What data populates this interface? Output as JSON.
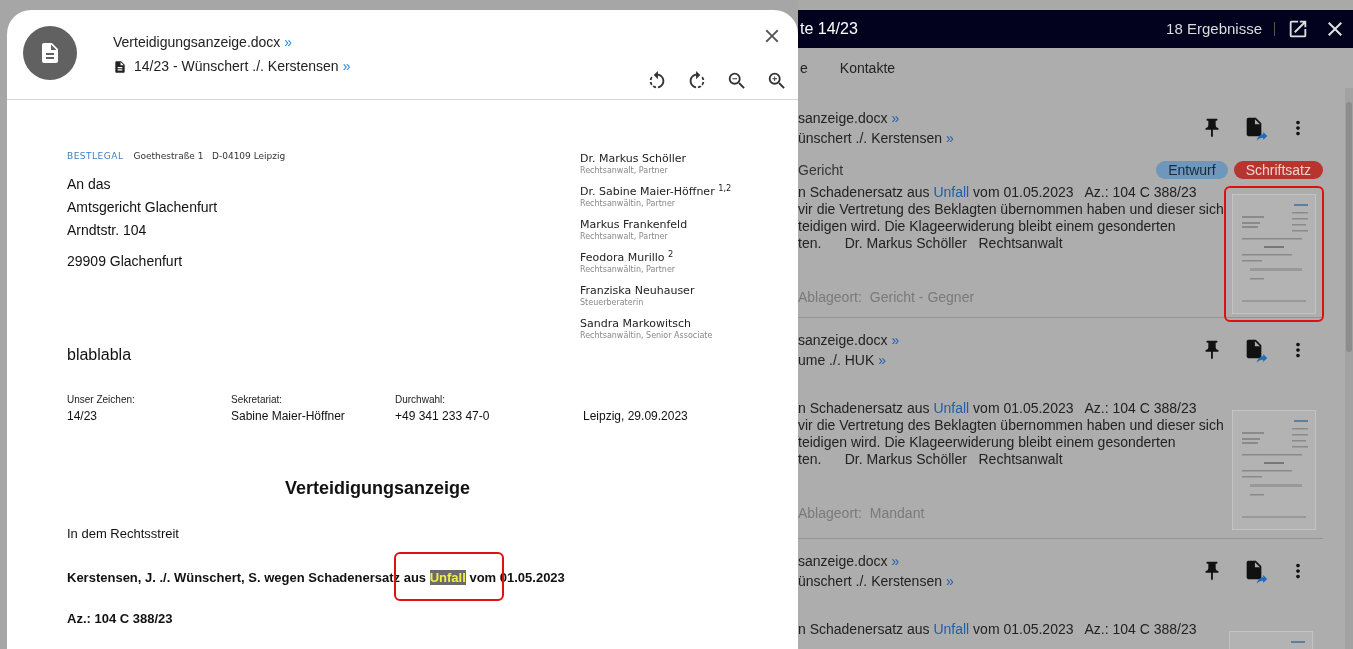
{
  "app": {
    "title": "te 14/23",
    "result_count": "18 Ergebnisse",
    "tabs": [
      {
        "label": "e",
        "selected": false
      },
      {
        "label": "Kontakte",
        "selected": false
      }
    ]
  },
  "results": [
    {
      "title": "sanzeige.docx",
      "title_link": "»",
      "case": "ünschert ./. Kerstensen",
      "case_link": "»",
      "category": "Gericht",
      "badges": [
        {
          "label": "Entwurf",
          "color": "#6f96bb"
        },
        {
          "label": "Schriftsatz",
          "color": "#b8352f"
        }
      ],
      "snippet": [
        [
          {
            "text": "n Schadenersatz aus ",
            "hit": false
          },
          {
            "text": "Unfall",
            "hit": true
          },
          {
            "text": " vom 01.05.2023   Az.: 104 C 388/23",
            "hit": false
          }
        ],
        [
          {
            "text": "vir die Vertretung des Beklagten übernommen haben und dieser sich",
            "hit": false
          }
        ],
        [
          {
            "text": "teidigen wird. Die Klageerwiderung bleibt einem gesonderten",
            "hit": false
          }
        ],
        [
          {
            "text": "ten.      Dr. Markus Schöller   Rechtsanwalt",
            "hit": false
          }
        ]
      ],
      "location_label": "Ablageort:",
      "location": "Gericht - Gegner",
      "thumbnail_outlined": true
    },
    {
      "title": "sanzeige.docx",
      "title_link": "»",
      "case": "ume ./. HUK",
      "case_link": "»",
      "snippet": [
        [
          {
            "text": "n Schadenersatz aus ",
            "hit": false
          },
          {
            "text": "Unfall",
            "hit": true
          },
          {
            "text": " vom 01.05.2023   Az.: 104 C 388/23",
            "hit": false
          }
        ],
        [
          {
            "text": "vir die Vertretung des Beklagten übernommen haben und dieser sich",
            "hit": false
          }
        ],
        [
          {
            "text": "teidigen wird. Die Klageerwiderung bleibt einem gesonderten",
            "hit": false
          }
        ],
        [
          {
            "text": "ten.      Dr. Markus Schöller   Rechtsanwalt",
            "hit": false
          }
        ]
      ],
      "location_label": "Ablageort:",
      "location": "Mandant",
      "thumbnail_outlined": false
    },
    {
      "title": "sanzeige.docx",
      "title_link": "»",
      "case": "ünschert ./. Kerstensen",
      "case_link": "»",
      "snippet": [
        [
          {
            "text": "n Schadenersatz aus ",
            "hit": false
          },
          {
            "text": "Unfall",
            "hit": true
          },
          {
            "text": " vom 01.05.2023   Az.: 104 C 388/23",
            "hit": false
          }
        ]
      ],
      "thumbnail_outlined": false
    }
  ],
  "viewer": {
    "file_name": "Verteidigungsanzeige.docx",
    "file_link": "»",
    "case": "14/23 - Wünschert ./. Kerstensen",
    "case_link": "»",
    "document": {
      "firm": "BESTLEGAL",
      "firm_address": "Goethestraße 1   D-04109 Leipzig",
      "recipient": [
        "An das",
        "Amtsgericht Glachenfurt",
        "Arndtstr. 104"
      ],
      "recipient_city": "29909 Glachenfurt",
      "note": "blablabla",
      "partners": [
        {
          "name": "Dr. Markus Schöller",
          "role": "Rechtsanwalt, Partner"
        },
        {
          "name": "Dr. Sabine Maier-Höffner $^{1,2}$",
          "role": "Rechtsanwältin, Partner"
        },
        {
          "name": "Markus Frankenfeld",
          "role": "Rechtsanwalt, Partner"
        },
        {
          "name": "Feodora Murillo $^{2}$",
          "role": "Rechtsanwältin, Partner"
        },
        {
          "name": "Franziska Neuhauser",
          "role": "Steuerberaterin"
        },
        {
          "name": "Sandra Markowitsch",
          "role": "Rechtsanwältin, Senior Associate"
        }
      ],
      "info": [
        {
          "label": "Unser Zeichen:",
          "value": "14/23"
        },
        {
          "label": "Sekretariat:",
          "value": "Sabine Maier-Höffner"
        },
        {
          "label": "Durchwahl:",
          "value": "+49 341 233 47-0"
        }
      ],
      "date": "Leipzig, 29.09.2023",
      "heading": "Verteidigungsanzeige",
      "intro": "In dem Rechtsstreit",
      "parties": [
        {
          "text": "Kerstensen, J. ./. Wünschert, S. wegen Schadenersatz ",
          "highlighted": false,
          "framed": false
        },
        {
          "text": "aus ",
          "highlighted": false,
          "framed": true
        },
        {
          "text": "Unfall",
          "highlighted": true,
          "framed": true
        },
        {
          "text": " vom",
          "highlighted": false,
          "framed": true
        },
        {
          "text": " 01.05.2023",
          "highlighted": false,
          "framed": false
        }
      ],
      "reference": "Az.: 104 C 388/23"
    }
  }
}
